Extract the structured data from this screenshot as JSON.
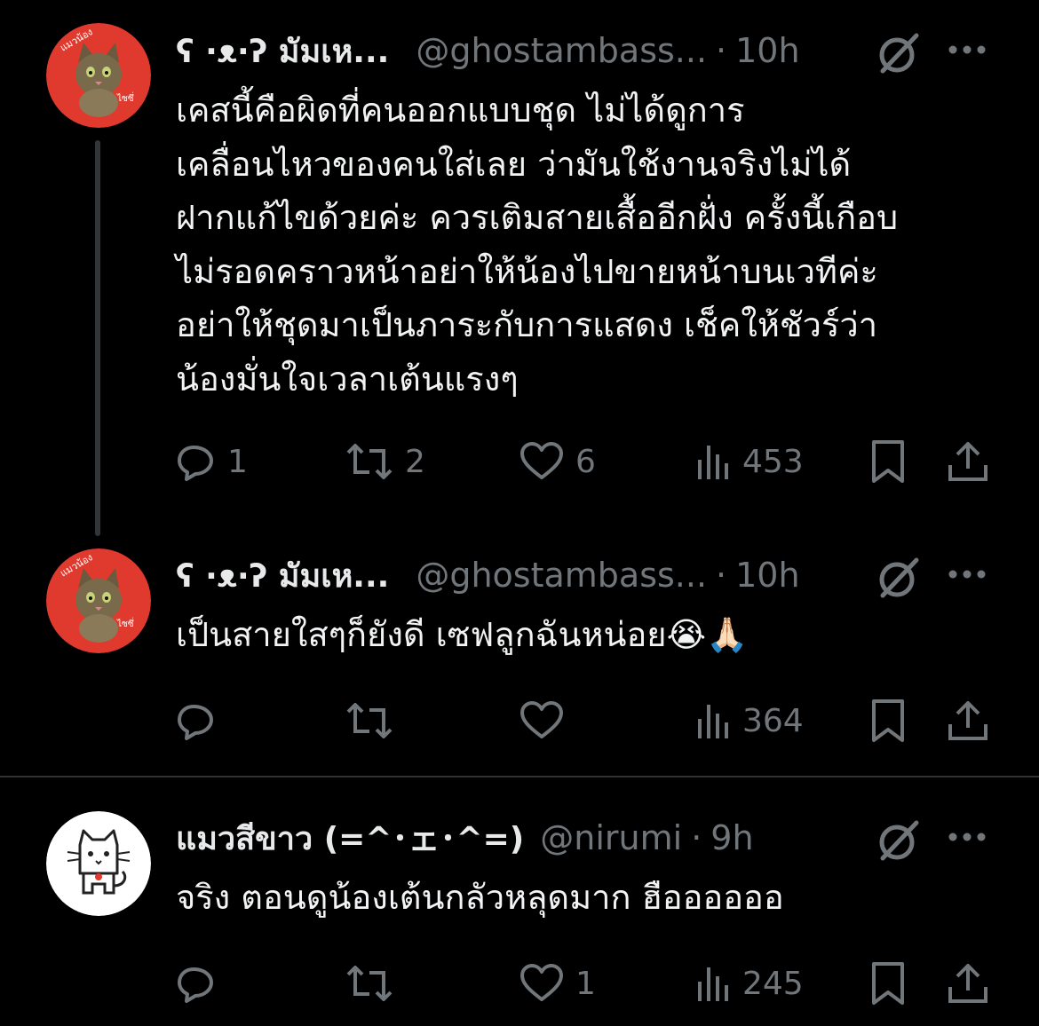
{
  "colors": {
    "background": "#000000",
    "text": "#e7e9ea",
    "muted": "#71767b",
    "divider": "#2f3336",
    "avatar_red": "#e0392d"
  },
  "tweets": [
    {
      "avatar": {
        "icon": "cat-avatar-red",
        "caption_top": "แมวน้อง",
        "caption_bottom": "ไซซึ่"
      },
      "name": "ʕ ·ᴥ·ʔ มัมเห...",
      "handle": "@ghostambass...",
      "separator": "·",
      "time": "10h",
      "text": "เคสนี้คือผิดที่คนออกแบบชุด ไม่ได้ดูการ\nเคลื่อนไหวของคนใส่เลย ว่ามันใช้งานจริงไม่ได้\nฝากแก้ไขด้วยค่ะ ควรเติมสายเสื้ออีกฝั่ง ครั้งนี้เกือบ\nไม่รอดคราวหน้าอย่าให้น้องไปขายหน้าบนเวทีค่ะ\nอย่าให้ชุดมาเป็นภาระกับการแสดง เช็คให้ชัวร์ว่า\nน้องมั่นใจเวลาเต้นแรงๆ",
      "replies": "1",
      "retweets": "2",
      "likes": "6",
      "views": "453"
    },
    {
      "avatar": {
        "icon": "cat-avatar-red",
        "caption_top": "แมวน้อง",
        "caption_bottom": "ไซซึ่"
      },
      "name": "ʕ ·ᴥ·ʔ มัมเห...",
      "handle": "@ghostambass...",
      "separator": "·",
      "time": "10h",
      "text": "เป็นสายใสๆก็ยังดี เซฟลูกฉันหน่อย😭🙏🏻",
      "replies": "",
      "retweets": "",
      "likes": "",
      "views": "364"
    },
    {
      "avatar": {
        "icon": "white-cat-avatar"
      },
      "name": "แมวสีขาว (=^･ェ･^=)",
      "handle": "@nirumi",
      "separator": "·",
      "time": "9h",
      "text": "จริง ตอนดูน้องเต้นกลัวหลุดมาก ฮืออออออ",
      "replies": "",
      "retweets": "",
      "likes": "1",
      "views": "245"
    }
  ]
}
